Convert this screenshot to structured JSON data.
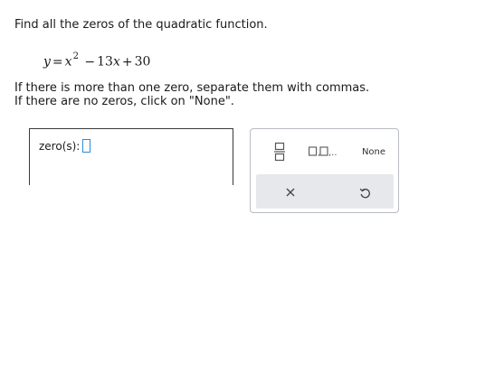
{
  "problem": {
    "instruction": "Find all the zeros of the quadratic function.",
    "equation": {
      "lhs": "y",
      "equals": "=",
      "var": "x",
      "exponent": "2",
      "minus": "−",
      "coef": "13",
      "plus": "+",
      "constant": "30"
    },
    "note_line1": "If there is more than one zero, separate them with commas.",
    "note_line2": "If there are no zeros, click on \"None\"."
  },
  "answer": {
    "label": "zero(s):",
    "value": ""
  },
  "keypad": {
    "fraction_icon": "fraction-icon",
    "list_icon": "list-of-values-icon",
    "none_label": "None",
    "clear_icon": "close-icon",
    "undo_icon": "undo-icon",
    "accent_color": "#2a8bd6",
    "bar_color": "#e6e8eb"
  }
}
